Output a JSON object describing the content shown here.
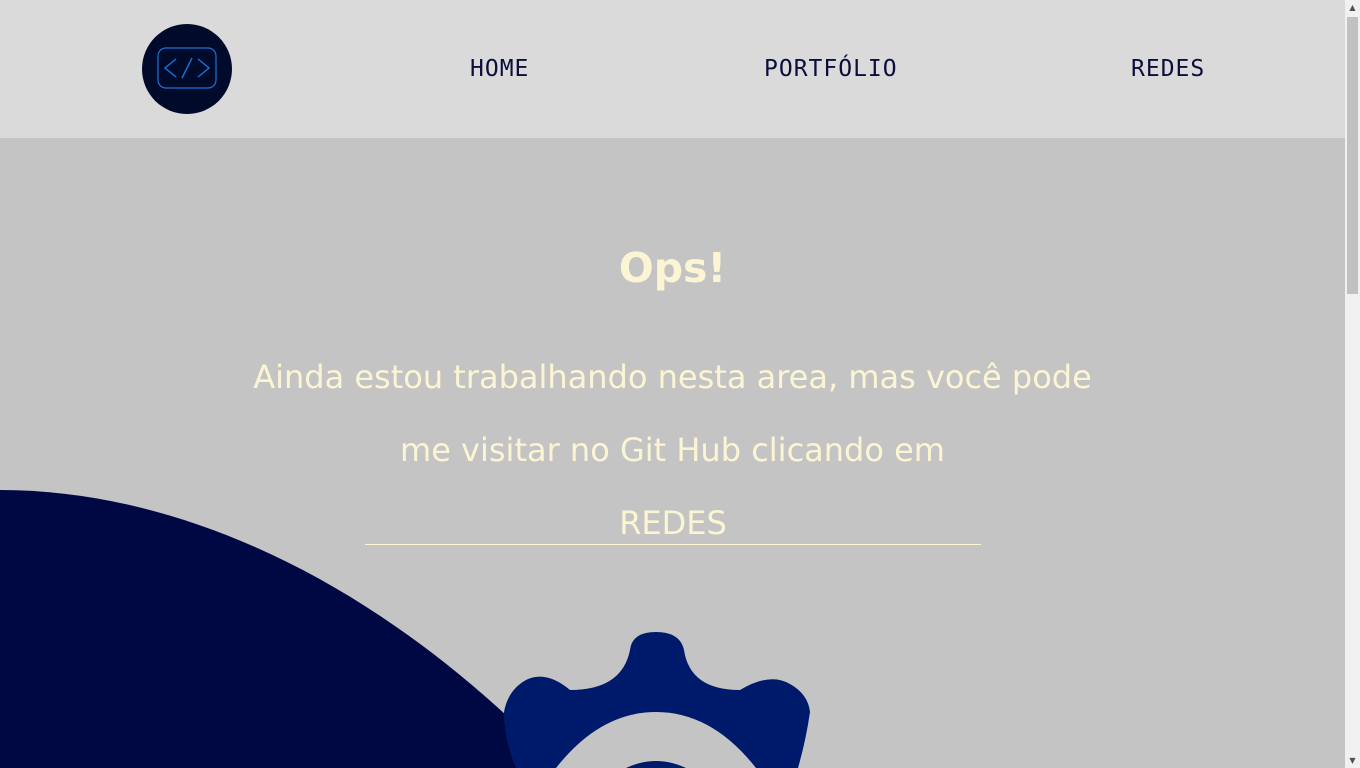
{
  "header": {
    "logo_icon": "code-brackets-icon",
    "nav": {
      "home": "HOME",
      "portfolio": "PORTFÓLIO",
      "redes": "REDES"
    }
  },
  "main": {
    "title": "Ops!",
    "message_line1": "Ainda estou trabalhando nesta area, mas você pode",
    "message_line2": "me visitar no Git Hub clicando em",
    "cta_link": "REDES",
    "illustration_icon": "gear-icon"
  },
  "colors": {
    "header_bg": "#dadada",
    "page_bg": "#c4c4c4",
    "navy": "#000b44",
    "gear": "#001a6b",
    "text_light": "#fcf5d4",
    "nav_text": "#0b0e3a"
  },
  "scrollbar": {
    "up_icon": "scroll-up-arrow-icon",
    "down_icon": "scroll-down-arrow-icon"
  }
}
